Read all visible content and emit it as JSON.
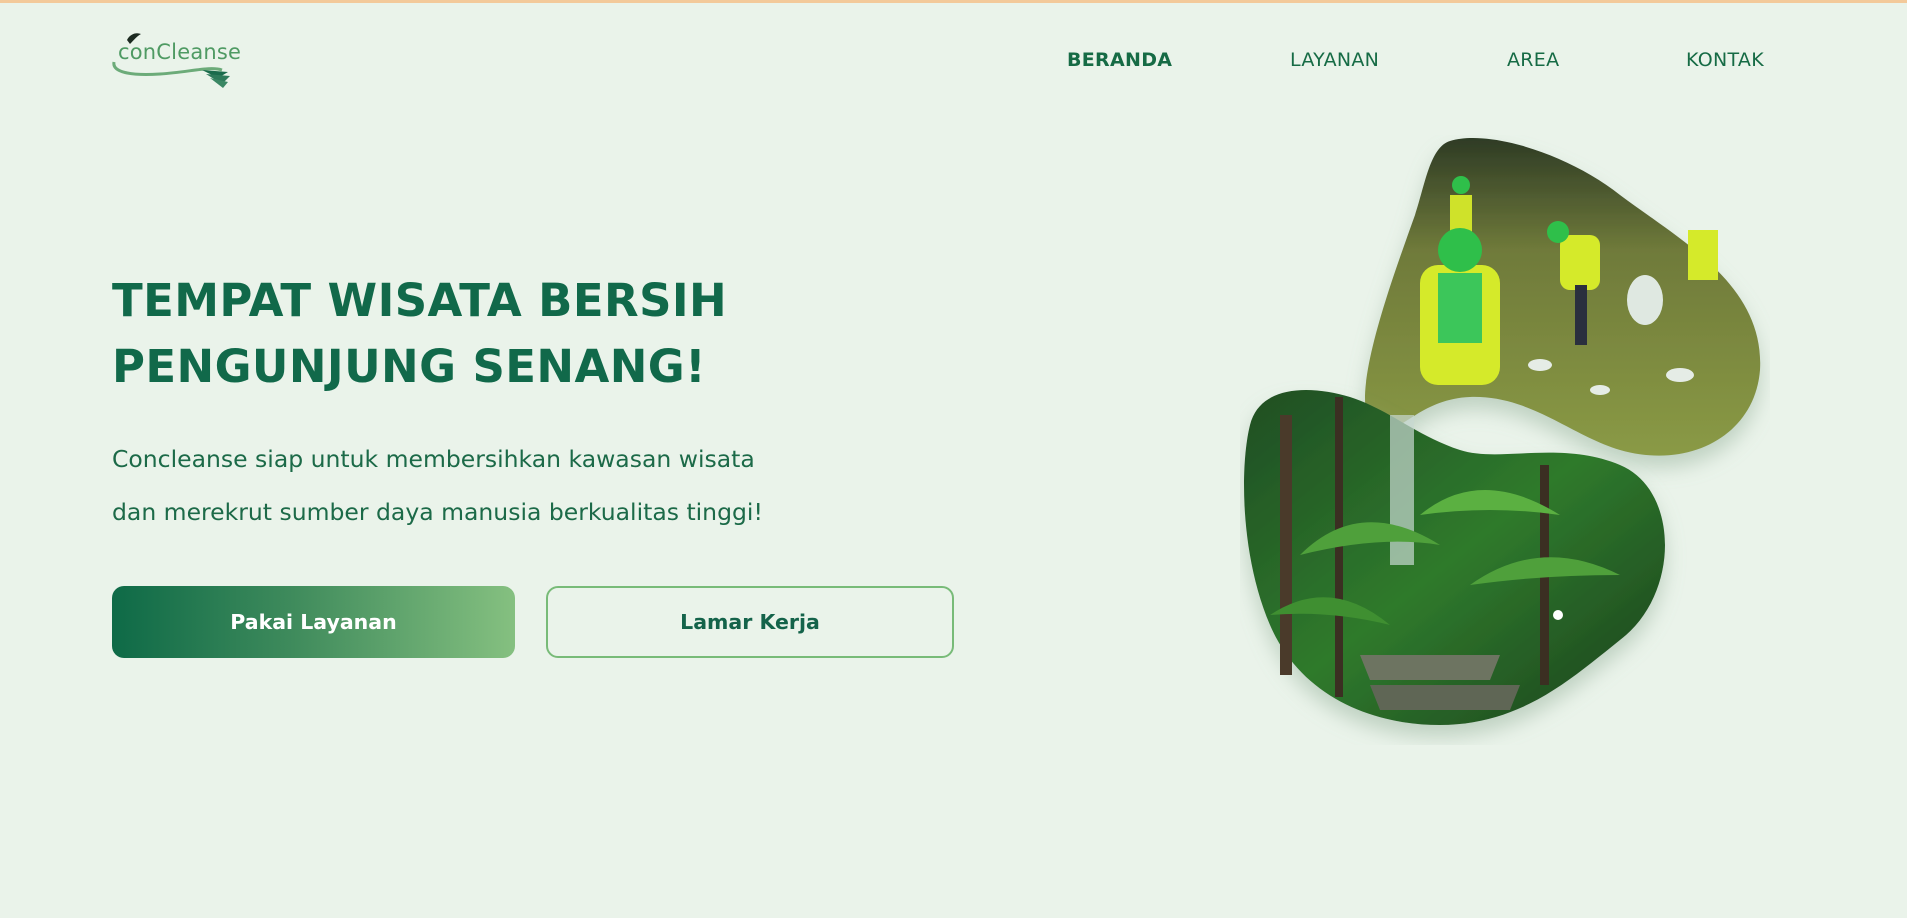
{
  "brand": {
    "logo_text": "onCleanse",
    "logo_letter": "c"
  },
  "nav": {
    "items": [
      {
        "label": "BERANDA",
        "active": true
      },
      {
        "label": "LAYANAN",
        "active": false
      },
      {
        "label": "AREA",
        "active": false
      },
      {
        "label": "KONTAK",
        "active": false
      }
    ]
  },
  "hero": {
    "title_line1": "TEMPAT WISATA BERSIH",
    "title_line2": "PENGUNJUNG SENANG!",
    "desc_line1": "Concleanse siap untuk membersihkan kawasan wisata",
    "desc_line2": "dan merekrut sumber daya manusia berkualitas tinggi!",
    "primary_button": "Pakai Layanan",
    "secondary_button": "Lamar Kerja"
  },
  "illustration": {
    "top_image": "volunteers-cleaning-park-photo",
    "bottom_image": "forest-ferns-stairs-photo"
  },
  "colors": {
    "background": "#eaf3ea",
    "primary": "#11694a",
    "accent_light": "#85c080",
    "top_border": "#f3c99a"
  }
}
